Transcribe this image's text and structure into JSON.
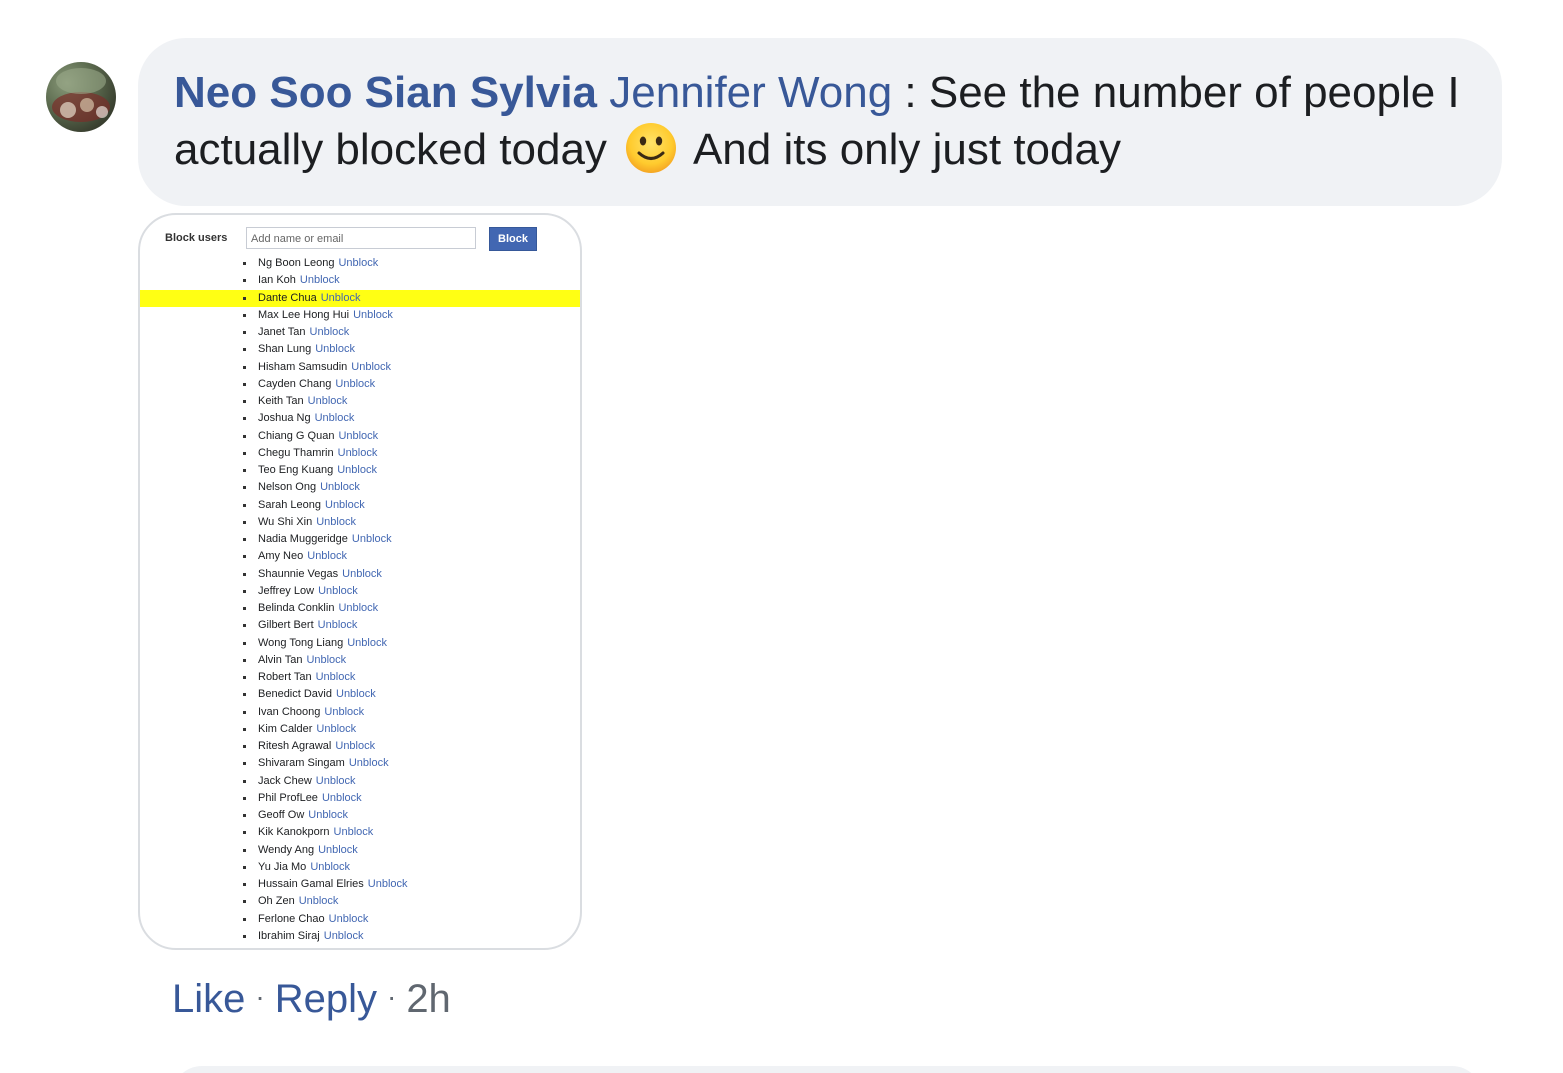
{
  "comment": {
    "author": "Neo Soo Sian Sylvia",
    "mention": "Jennifer Wong",
    "text_before_emoji": " : See the number of people I actually blocked today ",
    "emoji": "slightly-smiling-face-emoji",
    "text_after_emoji": " And its only just today",
    "avatar": "user-avatar-photo"
  },
  "attachment": {
    "block_label": "Block users",
    "input_placeholder": "Add name or email",
    "block_button": "Block",
    "unblock_label": "Unblock",
    "highlight_color": "#ffff14",
    "blocked_users": [
      {
        "name": "Ng Boon Leong"
      },
      {
        "name": "Ian Koh"
      },
      {
        "name": "Dante Chua",
        "highlighted": true
      },
      {
        "name": "Max Lee Hong Hui"
      },
      {
        "name": "Janet Tan"
      },
      {
        "name": "Shan Lung"
      },
      {
        "name": "Hisham Samsudin"
      },
      {
        "name": "Cayden Chang"
      },
      {
        "name": "Keith Tan"
      },
      {
        "name": "Joshua Ng"
      },
      {
        "name": "Chiang G Quan"
      },
      {
        "name": "Chegu Thamrin"
      },
      {
        "name": "Teo Eng Kuang"
      },
      {
        "name": "Nelson Ong"
      },
      {
        "name": "Sarah Leong"
      },
      {
        "name": "Wu Shi Xin"
      },
      {
        "name": "Nadia Muggeridge"
      },
      {
        "name": "Amy Neo"
      },
      {
        "name": "Shaunnie Vegas"
      },
      {
        "name": "Jeffrey Low"
      },
      {
        "name": "Belinda Conklin"
      },
      {
        "name": "Gilbert Bert"
      },
      {
        "name": "Wong Tong Liang"
      },
      {
        "name": "Alvin Tan"
      },
      {
        "name": "Robert Tan"
      },
      {
        "name": "Benedict David"
      },
      {
        "name": "Ivan Choong"
      },
      {
        "name": "Kim Calder"
      },
      {
        "name": "Ritesh Agrawal"
      },
      {
        "name": "Shivaram Singam"
      },
      {
        "name": "Jack Chew"
      },
      {
        "name": "Phil ProfLee"
      },
      {
        "name": "Geoff Ow"
      },
      {
        "name": "Kik Kanokporn"
      },
      {
        "name": "Wendy Ang"
      },
      {
        "name": "Yu Jia Mo"
      },
      {
        "name": "Hussain Gamal Elries"
      },
      {
        "name": "Oh Zen"
      },
      {
        "name": "Ferlone Chao"
      },
      {
        "name": "Ibrahim Siraj"
      }
    ]
  },
  "actions": {
    "like": "Like",
    "separator": "·",
    "reply": "Reply",
    "timestamp": "2h"
  },
  "colors": {
    "link_blue": "#385898",
    "bubble_bg": "#f0f2f5",
    "text": "#1c1e21",
    "meta": "#606770"
  }
}
